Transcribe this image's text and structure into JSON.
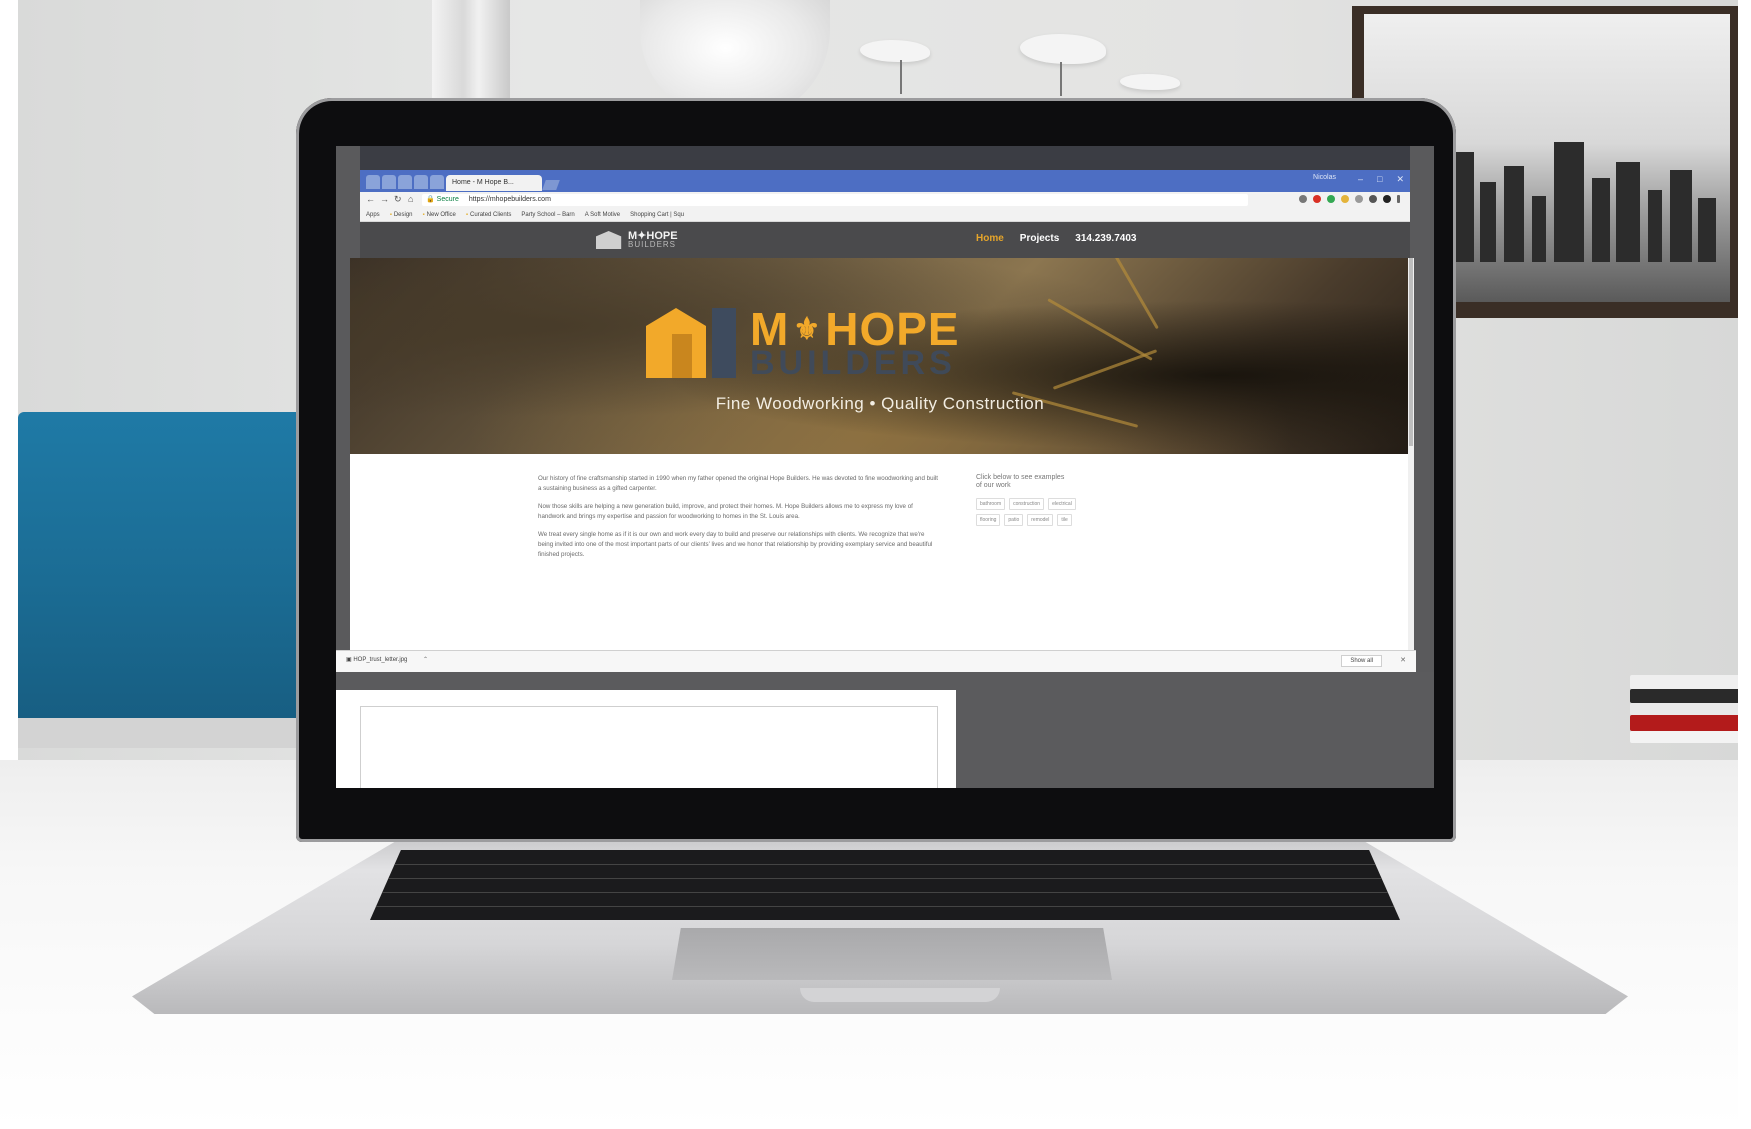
{
  "browser": {
    "active_tab_title": "Home - M Hope B...",
    "window_user": "Nicolas",
    "window_controls": [
      "–",
      "□",
      "✕"
    ],
    "omnibox": {
      "security": "Secure",
      "url": "https://mhopebuilders.com"
    },
    "bookmarks": [
      "Apps",
      "Design",
      "New Office",
      "Curated Clients",
      "Party School – Barn",
      "A Soft Motive",
      "Shopping Cart | Squ"
    ]
  },
  "site": {
    "nav_logo_text": "M✦HOPE",
    "nav_logo_sub": "BUILDERS",
    "menu": {
      "home": "Home",
      "projects": "Projects",
      "phone": "314.239.7403"
    },
    "hero": {
      "logo_word_left": "M",
      "logo_fleur": "⚜",
      "logo_word_right": "HOPE",
      "logo_sub": "BUILDERS",
      "tagline": "Fine Woodworking • Quality Construction"
    },
    "about": [
      "Our history of fine craftsmanship started in 1990 when my father opened the original Hope Builders. He was devoted to fine woodworking and built a sustaining business as a gifted carpenter.",
      "Now those skills are helping a new generation build, improve, and protect their homes. M. Hope Builders allows me to express my love of handwork and brings my expertise and passion for woodworking to homes in the St. Louis area.",
      "We treat every single home as if it is our own and work every day to build and preserve our relationships with clients. We recognize that we're being invited into one of the most important parts of our clients' lives and we honor that relationship by providing exemplary service and beautiful finished projects."
    ],
    "sidebar": {
      "title": "Click below to see examples of our work",
      "tags": [
        "bathroom",
        "construction",
        "electrical",
        "flooring",
        "patio",
        "remodel",
        "tile"
      ]
    }
  },
  "download_bar": {
    "file": "HOP_trust_letter.jpg",
    "caret": "⌃",
    "show_all": "Show all",
    "close": "✕"
  },
  "colors": {
    "accent_orange": "#f2a92a",
    "chrome_blue": "#4d6ec3",
    "nav_gray": "#4a4a4c"
  }
}
